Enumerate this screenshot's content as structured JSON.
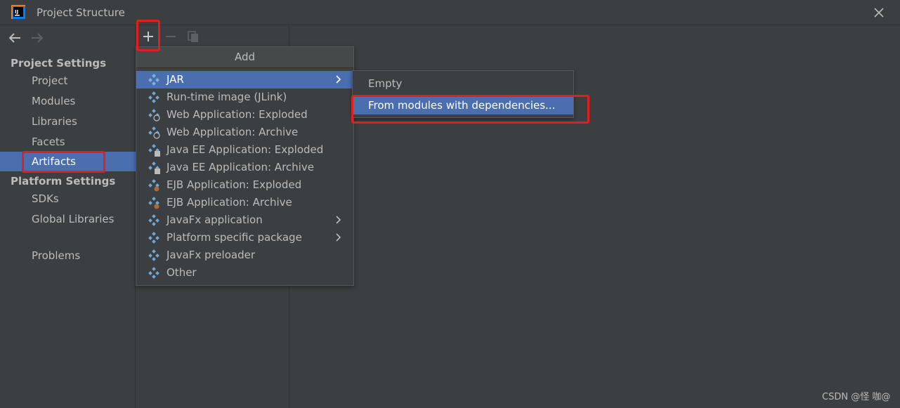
{
  "window": {
    "title": "Project Structure"
  },
  "sidebar": {
    "project_settings_title": "Project Settings",
    "project_items": [
      {
        "label": "Project"
      },
      {
        "label": "Modules"
      },
      {
        "label": "Libraries"
      },
      {
        "label": "Facets"
      },
      {
        "label": "Artifacts",
        "selected": true
      }
    ],
    "platform_settings_title": "Platform Settings",
    "platform_items": [
      {
        "label": "SDKs"
      },
      {
        "label": "Global Libraries"
      }
    ],
    "problems_label": "Problems"
  },
  "toolbar": {
    "add_icon": "plus-icon",
    "remove_icon": "minus-icon",
    "copy_icon": "copy-icon"
  },
  "add_menu": {
    "header": "Add",
    "items": [
      {
        "label": "JAR",
        "icon": "artifact-icon",
        "submenu": true,
        "active": true
      },
      {
        "label": "Run-time image (JLink)",
        "icon": "artifact-icon"
      },
      {
        "label": "Web Application: Exploded",
        "icon": "web-artifact-icon"
      },
      {
        "label": "Web Application: Archive",
        "icon": "web-artifact-icon"
      },
      {
        "label": "Java EE Application: Exploded",
        "icon": "javaee-artifact-icon"
      },
      {
        "label": "Java EE Application: Archive",
        "icon": "javaee-artifact-icon"
      },
      {
        "label": "EJB Application: Exploded",
        "icon": "ejb-artifact-icon"
      },
      {
        "label": "EJB Application: Archive",
        "icon": "ejb-artifact-icon"
      },
      {
        "label": "JavaFx application",
        "icon": "artifact-icon",
        "submenu": true
      },
      {
        "label": "Platform specific package",
        "icon": "artifact-icon",
        "submenu": true
      },
      {
        "label": "JavaFx preloader",
        "icon": "artifact-icon"
      },
      {
        "label": "Other",
        "icon": "artifact-icon"
      }
    ]
  },
  "jar_submenu": {
    "items": [
      {
        "label": "Empty"
      },
      {
        "label": "From modules with dependencies...",
        "active": true
      }
    ]
  },
  "watermark": "CSDN @怪 咖@",
  "colors": {
    "accent": "#4b6eaf",
    "background": "#3c3f41",
    "highlight": "#e02020"
  }
}
